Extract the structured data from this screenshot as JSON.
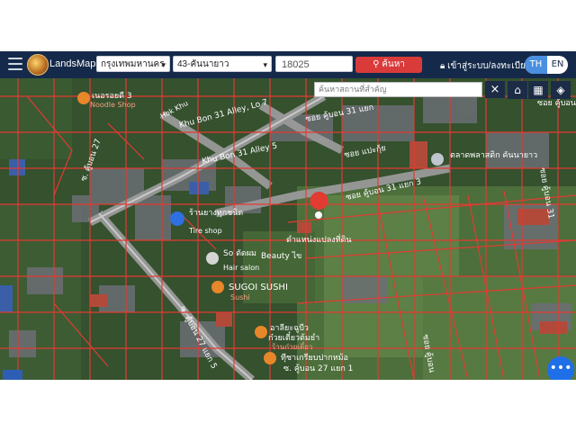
{
  "app": {
    "brand": "LandsMaps"
  },
  "search": {
    "province": "กรุงเทพมหานคร",
    "district": "43-คันนายาว",
    "parcel_value": "18025",
    "search_label": "ค้นหา"
  },
  "account": {
    "login_label": "เข้าสู่ระบบ/ลงทะเบียน"
  },
  "lang": {
    "th": "TH",
    "en": "EN"
  },
  "map": {
    "place_search_placeholder": "ค้นหาสถานที่สำคัญ",
    "close_label": "×",
    "labels": {
      "noodle_th": "เนอรอยดี 3",
      "noodle_en": "Noodle Shop",
      "hok_khu": "Hok Khu",
      "khu_bon_31_alley": "Khu Bon 31 Alley, Lo 7",
      "khu_bon_31_alley5": "Khu Bon 31 Alley 5",
      "soi_khubon_27": "ซ. คู้บอน 27",
      "soi_khubon_31": "ซอย คู้บอน 31 แยก",
      "soi_khubon_31b": "ซอย คู้บอน 31 แยก 3",
      "soi_peng": "ซอย แปะกุ้ย",
      "market": "ตลาดพลาสติก คันนายาว",
      "tire_th": "ร้านยางทุกชนิด",
      "tire_en": "Tire shop",
      "parcel_loc": "ตำแหน่งแปลงที่ดิน",
      "beauty": "Beauty ไข",
      "hair_th": "So ตัดผม",
      "hair_en": "Hair salon",
      "sushi": "SUGOI SUSHI",
      "sushi_en": "Sushi",
      "noodle2_th": "อาลียะฉูบีว",
      "noodle2_sub": "ก๋วยเตี๋ยวต้มยำ",
      "noodle2_en": "ร้านก๋วยเตี๋ยว",
      "bangkok_mo": "ทีุ่ชาเกรียบปากหม้อ",
      "soi_27_5": "ซ. คู้บอน 27 แยก 5",
      "soi_27_1": "ซ. คู้บอน 27 แยก 1",
      "soi_right": "ซอย คู้บอน",
      "soi_right2": "ซอย คู้บอน 31",
      "cluster": "ซอย คู้บอน 31"
    }
  },
  "fab": {
    "label": "•••"
  }
}
